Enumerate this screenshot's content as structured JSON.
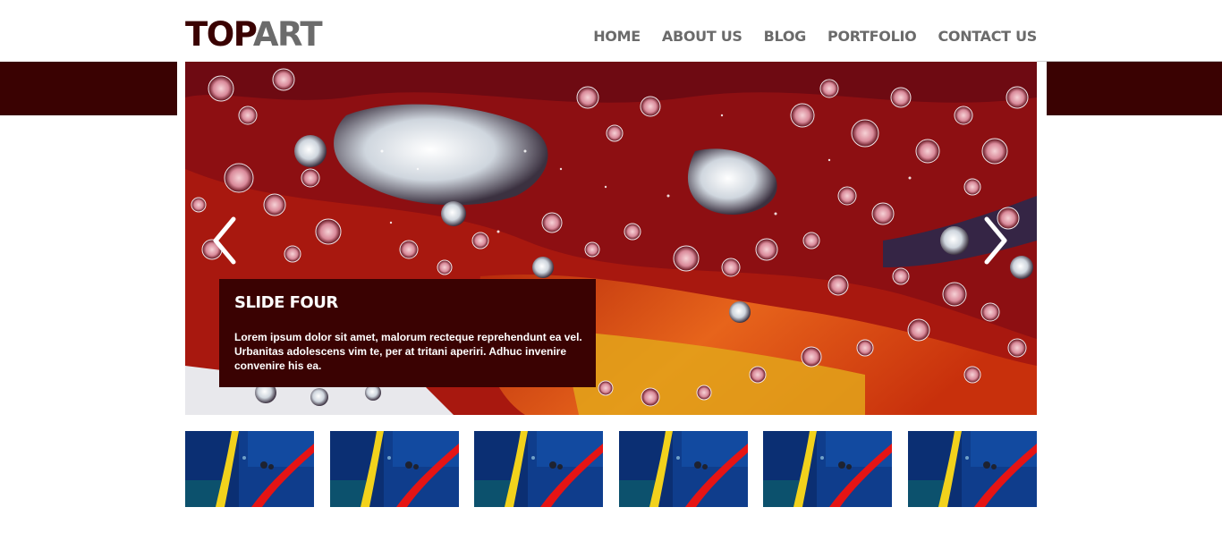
{
  "header": {
    "logo_part1": "TOP",
    "logo_part2": "ART",
    "nav": [
      {
        "label": "HOME"
      },
      {
        "label": "ABOUT US"
      },
      {
        "label": "BLOG"
      },
      {
        "label": "PORTFOLIO"
      },
      {
        "label": "CONTACT US"
      }
    ]
  },
  "slider": {
    "caption_title": "SLIDE FOUR",
    "caption_text": "Lorem ipsum dolor sit amet, malorum recteque reprehendunt ea vel. Urbanitas adolescens vim te, per at tritani aperiri. Adhuc invenire convenire his ea.",
    "prev_icon": "chevron-left-icon",
    "next_icon": "chevron-right-icon"
  },
  "thumbnails": {
    "count": 6,
    "image": "blue-abstract-painting-with-yellow-and-red-lines"
  },
  "colors": {
    "brand_dark": "#3a0202",
    "nav_gray": "#6b6b6b",
    "background": "#ffffff"
  }
}
